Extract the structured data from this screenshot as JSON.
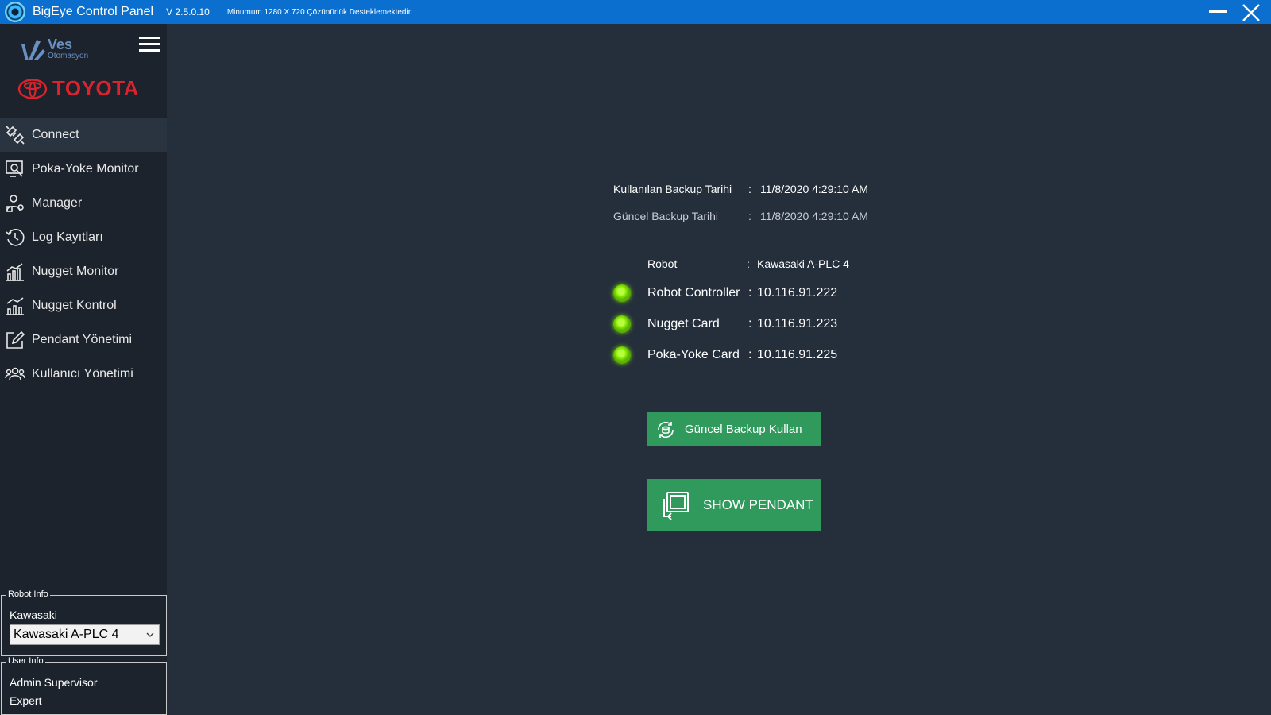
{
  "window": {
    "title": "BigEye Control Panel",
    "version": "V 2.5.0.10",
    "note": "Minumum 1280 X 720 Çözünürlük Desteklemektedir."
  },
  "branding": {
    "ves_name": "Ves",
    "ves_sub": "Otomasyon",
    "toyota": "TOYOTA",
    "toyota_color": "#d9232e"
  },
  "sidebar": {
    "items": [
      {
        "label": "Connect",
        "icon": "connect-icon"
      },
      {
        "label": "Poka-Yoke Monitor",
        "icon": "monitor-search-icon"
      },
      {
        "label": "Manager",
        "icon": "manager-icon"
      },
      {
        "label": "Log Kayıtları",
        "icon": "clock-history-icon"
      },
      {
        "label": "Nugget Monitor",
        "icon": "bar-chart-icon"
      },
      {
        "label": "Nugget Kontrol",
        "icon": "chart-control-icon"
      },
      {
        "label": "Pendant Yönetimi",
        "icon": "edit-icon"
      },
      {
        "label": "Kullanıcı Yönetimi",
        "icon": "users-icon"
      }
    ],
    "robot_info": {
      "legend": "Robot Info",
      "brand": "Kawasaki",
      "selected": "Kawasaki A-PLC 4"
    },
    "user_info": {
      "legend": "User Info",
      "name": "Admin Supervisor",
      "role": "Expert"
    }
  },
  "main": {
    "backup_used_label": "Kullanılan Backup Tarihi",
    "backup_used_value": "11/8/2020 4:29:10 AM",
    "backup_current_label": "Güncel Backup Tarihi",
    "backup_current_value": "11/8/2020 4:29:10 AM",
    "separator": ":",
    "robot_label": "Robot",
    "robot_value": "Kawasaki A-PLC 4",
    "devices": [
      {
        "label": "Robot Controller",
        "ip": "10.116.91.222",
        "status": "online"
      },
      {
        "label": "Nugget Card",
        "ip": "10.116.91.223",
        "status": "online"
      },
      {
        "label": "Poka-Yoke Card",
        "ip": "10.116.91.225",
        "status": "online"
      }
    ],
    "btn_backup": "Güncel Backup Kullan",
    "btn_pendant": "SHOW PENDANT"
  },
  "colors": {
    "titlebar": "#0a6fce",
    "sidebar": "#1c232c",
    "background": "#252f3c",
    "button": "#2f9a5c",
    "led": "#7fe000"
  }
}
